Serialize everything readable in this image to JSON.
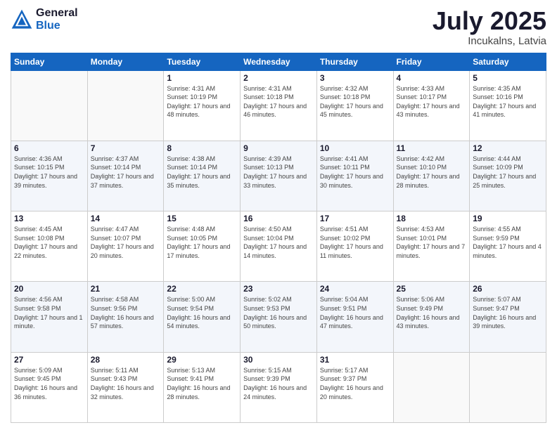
{
  "header": {
    "logo_line1": "General",
    "logo_line2": "Blue",
    "month_title": "July 2025",
    "location": "Incukalns, Latvia"
  },
  "weekdays": [
    "Sunday",
    "Monday",
    "Tuesday",
    "Wednesday",
    "Thursday",
    "Friday",
    "Saturday"
  ],
  "weeks": [
    [
      {
        "day": "",
        "sunrise": "",
        "sunset": "",
        "daylight": ""
      },
      {
        "day": "",
        "sunrise": "",
        "sunset": "",
        "daylight": ""
      },
      {
        "day": "1",
        "sunrise": "Sunrise: 4:31 AM",
        "sunset": "Sunset: 10:19 PM",
        "daylight": "Daylight: 17 hours and 48 minutes."
      },
      {
        "day": "2",
        "sunrise": "Sunrise: 4:31 AM",
        "sunset": "Sunset: 10:18 PM",
        "daylight": "Daylight: 17 hours and 46 minutes."
      },
      {
        "day": "3",
        "sunrise": "Sunrise: 4:32 AM",
        "sunset": "Sunset: 10:18 PM",
        "daylight": "Daylight: 17 hours and 45 minutes."
      },
      {
        "day": "4",
        "sunrise": "Sunrise: 4:33 AM",
        "sunset": "Sunset: 10:17 PM",
        "daylight": "Daylight: 17 hours and 43 minutes."
      },
      {
        "day": "5",
        "sunrise": "Sunrise: 4:35 AM",
        "sunset": "Sunset: 10:16 PM",
        "daylight": "Daylight: 17 hours and 41 minutes."
      }
    ],
    [
      {
        "day": "6",
        "sunrise": "Sunrise: 4:36 AM",
        "sunset": "Sunset: 10:15 PM",
        "daylight": "Daylight: 17 hours and 39 minutes."
      },
      {
        "day": "7",
        "sunrise": "Sunrise: 4:37 AM",
        "sunset": "Sunset: 10:14 PM",
        "daylight": "Daylight: 17 hours and 37 minutes."
      },
      {
        "day": "8",
        "sunrise": "Sunrise: 4:38 AM",
        "sunset": "Sunset: 10:14 PM",
        "daylight": "Daylight: 17 hours and 35 minutes."
      },
      {
        "day": "9",
        "sunrise": "Sunrise: 4:39 AM",
        "sunset": "Sunset: 10:13 PM",
        "daylight": "Daylight: 17 hours and 33 minutes."
      },
      {
        "day": "10",
        "sunrise": "Sunrise: 4:41 AM",
        "sunset": "Sunset: 10:11 PM",
        "daylight": "Daylight: 17 hours and 30 minutes."
      },
      {
        "day": "11",
        "sunrise": "Sunrise: 4:42 AM",
        "sunset": "Sunset: 10:10 PM",
        "daylight": "Daylight: 17 hours and 28 minutes."
      },
      {
        "day": "12",
        "sunrise": "Sunrise: 4:44 AM",
        "sunset": "Sunset: 10:09 PM",
        "daylight": "Daylight: 17 hours and 25 minutes."
      }
    ],
    [
      {
        "day": "13",
        "sunrise": "Sunrise: 4:45 AM",
        "sunset": "Sunset: 10:08 PM",
        "daylight": "Daylight: 17 hours and 22 minutes."
      },
      {
        "day": "14",
        "sunrise": "Sunrise: 4:47 AM",
        "sunset": "Sunset: 10:07 PM",
        "daylight": "Daylight: 17 hours and 20 minutes."
      },
      {
        "day": "15",
        "sunrise": "Sunrise: 4:48 AM",
        "sunset": "Sunset: 10:05 PM",
        "daylight": "Daylight: 17 hours and 17 minutes."
      },
      {
        "day": "16",
        "sunrise": "Sunrise: 4:50 AM",
        "sunset": "Sunset: 10:04 PM",
        "daylight": "Daylight: 17 hours and 14 minutes."
      },
      {
        "day": "17",
        "sunrise": "Sunrise: 4:51 AM",
        "sunset": "Sunset: 10:02 PM",
        "daylight": "Daylight: 17 hours and 11 minutes."
      },
      {
        "day": "18",
        "sunrise": "Sunrise: 4:53 AM",
        "sunset": "Sunset: 10:01 PM",
        "daylight": "Daylight: 17 hours and 7 minutes."
      },
      {
        "day": "19",
        "sunrise": "Sunrise: 4:55 AM",
        "sunset": "Sunset: 9:59 PM",
        "daylight": "Daylight: 17 hours and 4 minutes."
      }
    ],
    [
      {
        "day": "20",
        "sunrise": "Sunrise: 4:56 AM",
        "sunset": "Sunset: 9:58 PM",
        "daylight": "Daylight: 17 hours and 1 minute."
      },
      {
        "day": "21",
        "sunrise": "Sunrise: 4:58 AM",
        "sunset": "Sunset: 9:56 PM",
        "daylight": "Daylight: 16 hours and 57 minutes."
      },
      {
        "day": "22",
        "sunrise": "Sunrise: 5:00 AM",
        "sunset": "Sunset: 9:54 PM",
        "daylight": "Daylight: 16 hours and 54 minutes."
      },
      {
        "day": "23",
        "sunrise": "Sunrise: 5:02 AM",
        "sunset": "Sunset: 9:53 PM",
        "daylight": "Daylight: 16 hours and 50 minutes."
      },
      {
        "day": "24",
        "sunrise": "Sunrise: 5:04 AM",
        "sunset": "Sunset: 9:51 PM",
        "daylight": "Daylight: 16 hours and 47 minutes."
      },
      {
        "day": "25",
        "sunrise": "Sunrise: 5:06 AM",
        "sunset": "Sunset: 9:49 PM",
        "daylight": "Daylight: 16 hours and 43 minutes."
      },
      {
        "day": "26",
        "sunrise": "Sunrise: 5:07 AM",
        "sunset": "Sunset: 9:47 PM",
        "daylight": "Daylight: 16 hours and 39 minutes."
      }
    ],
    [
      {
        "day": "27",
        "sunrise": "Sunrise: 5:09 AM",
        "sunset": "Sunset: 9:45 PM",
        "daylight": "Daylight: 16 hours and 36 minutes."
      },
      {
        "day": "28",
        "sunrise": "Sunrise: 5:11 AM",
        "sunset": "Sunset: 9:43 PM",
        "daylight": "Daylight: 16 hours and 32 minutes."
      },
      {
        "day": "29",
        "sunrise": "Sunrise: 5:13 AM",
        "sunset": "Sunset: 9:41 PM",
        "daylight": "Daylight: 16 hours and 28 minutes."
      },
      {
        "day": "30",
        "sunrise": "Sunrise: 5:15 AM",
        "sunset": "Sunset: 9:39 PM",
        "daylight": "Daylight: 16 hours and 24 minutes."
      },
      {
        "day": "31",
        "sunrise": "Sunrise: 5:17 AM",
        "sunset": "Sunset: 9:37 PM",
        "daylight": "Daylight: 16 hours and 20 minutes."
      },
      {
        "day": "",
        "sunrise": "",
        "sunset": "",
        "daylight": ""
      },
      {
        "day": "",
        "sunrise": "",
        "sunset": "",
        "daylight": ""
      }
    ]
  ]
}
